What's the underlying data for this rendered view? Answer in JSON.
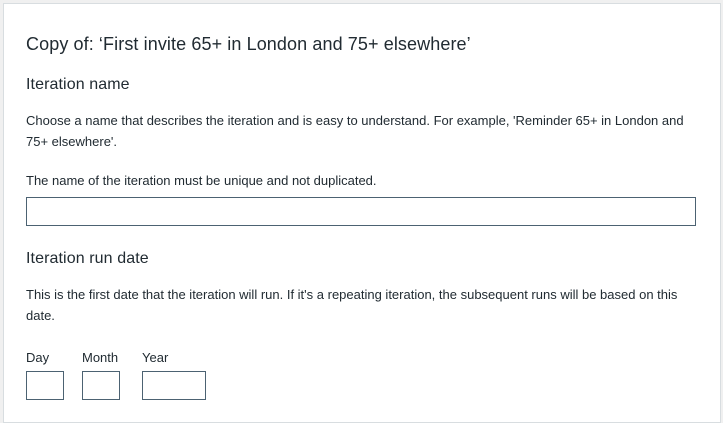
{
  "page": {
    "title": "Copy of: ‘First invite 65+ in London and 75+ elsewhere’"
  },
  "iteration_name": {
    "heading": "Iteration name",
    "hint_1": "Choose a name that describes the iteration and is easy to understand. For example, 'Reminder 65+ in London and 75+ elsewhere'.",
    "hint_2": "The name of the iteration must be unique and not duplicated.",
    "value": ""
  },
  "iteration_run_date": {
    "heading": "Iteration run date",
    "hint": "This is the first date that the iteration will run. If it's a repeating iteration, the subsequent runs will be based on this date.",
    "day_label": "Day",
    "month_label": "Month",
    "year_label": "Year",
    "day_value": "",
    "month_value": "",
    "year_value": ""
  }
}
